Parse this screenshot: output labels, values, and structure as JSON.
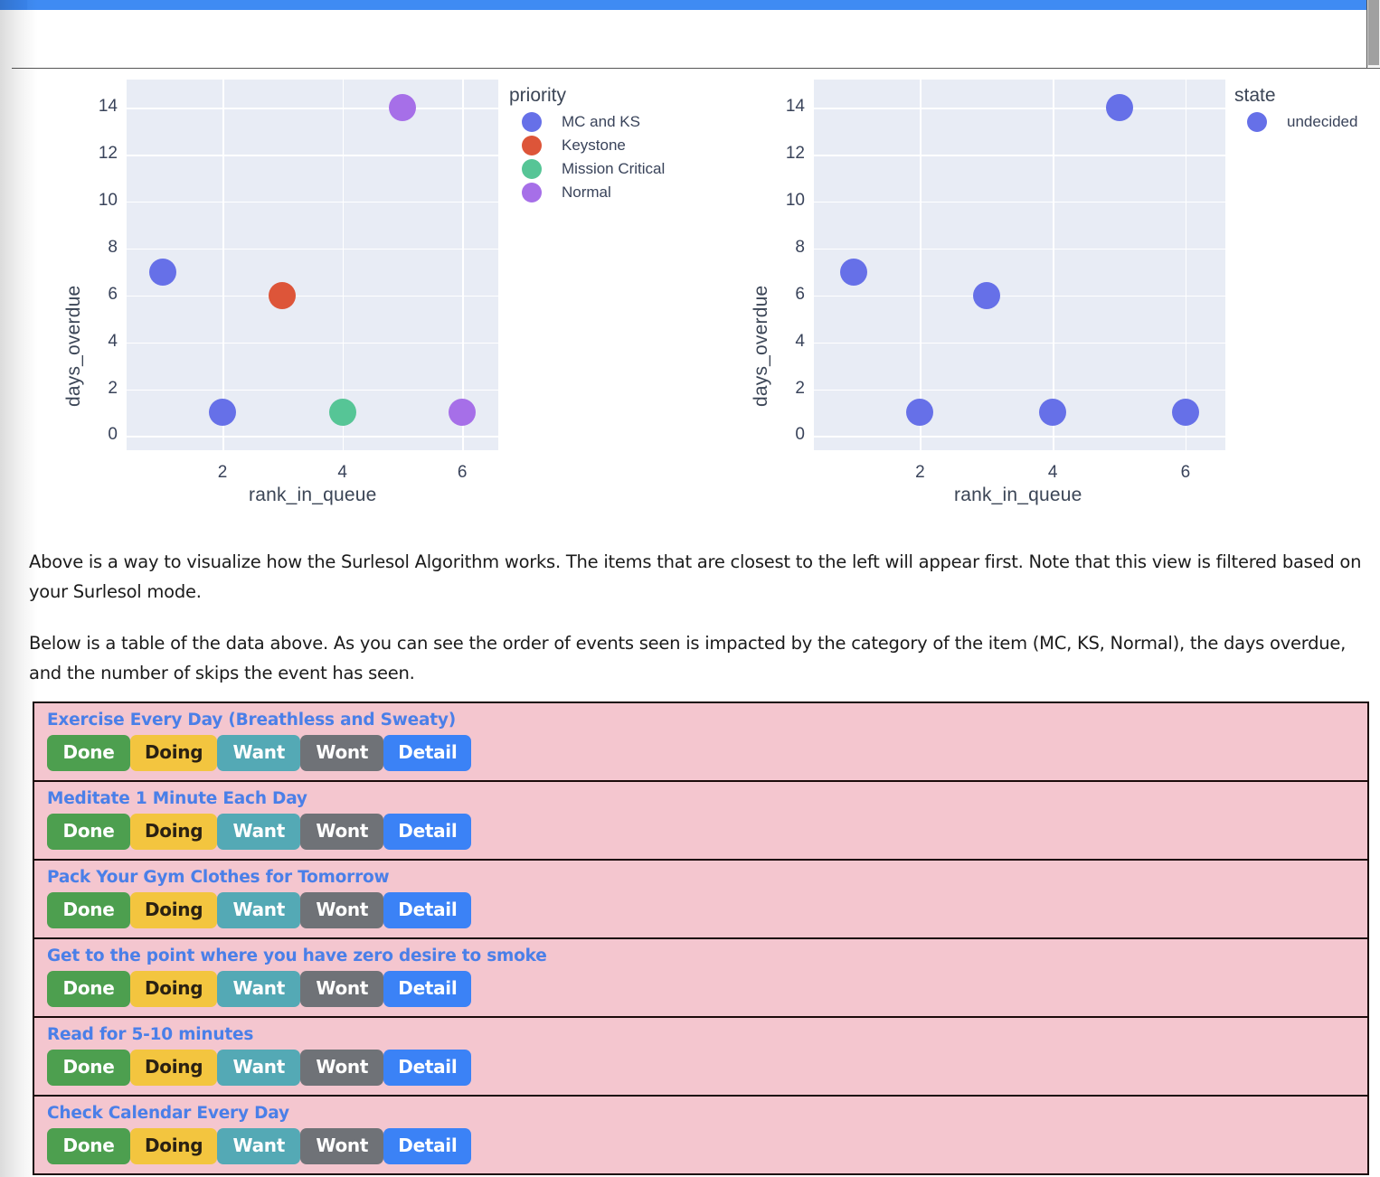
{
  "window": {
    "top_bar_color": "#3f8bf3",
    "scrollbar": {
      "name": "vertical-scrollbar"
    }
  },
  "chart_data": [
    {
      "type": "scatter",
      "title": "",
      "xlabel": "rank_in_queue",
      "ylabel": "days_overdue",
      "xlim": [
        0.4,
        6.6
      ],
      "ylim": [
        -0.6,
        15.2
      ],
      "xticks": [
        2,
        4,
        6
      ],
      "yticks": [
        0,
        2,
        4,
        6,
        8,
        10,
        12,
        14
      ],
      "grid": true,
      "legend": {
        "title": "priority",
        "position": "right",
        "entries": [
          {
            "label": "MC and KS",
            "color": "#6670e8"
          },
          {
            "label": "Keystone",
            "color": "#dd5539"
          },
          {
            "label": "Mission Critical",
            "color": "#56c596"
          },
          {
            "label": "Normal",
            "color": "#a66fe8"
          }
        ]
      },
      "series": [
        {
          "name": "MC and KS",
          "color": "#6670e8",
          "points": [
            [
              1,
              7
            ],
            [
              2,
              1
            ]
          ]
        },
        {
          "name": "Keystone",
          "color": "#dd5539",
          "points": [
            [
              3,
              6
            ]
          ]
        },
        {
          "name": "Mission Critical",
          "color": "#56c596",
          "points": [
            [
              4,
              1
            ]
          ]
        },
        {
          "name": "Normal",
          "color": "#a66fe8",
          "points": [
            [
              5,
              14
            ],
            [
              6,
              1
            ]
          ]
        }
      ]
    },
    {
      "type": "scatter",
      "title": "",
      "xlabel": "rank_in_queue",
      "ylabel": "days_overdue",
      "xlim": [
        0.4,
        6.6
      ],
      "ylim": [
        -0.6,
        15.2
      ],
      "xticks": [
        2,
        4,
        6
      ],
      "yticks": [
        0,
        2,
        4,
        6,
        8,
        10,
        12,
        14
      ],
      "grid": true,
      "legend": {
        "title": "state",
        "position": "right",
        "entries": [
          {
            "label": "undecided",
            "color": "#6670e8"
          }
        ]
      },
      "series": [
        {
          "name": "undecided",
          "color": "#6670e8",
          "points": [
            [
              1,
              7
            ],
            [
              2,
              1
            ],
            [
              3,
              6
            ],
            [
              4,
              1
            ],
            [
              5,
              14
            ],
            [
              6,
              1
            ]
          ]
        }
      ]
    }
  ],
  "paragraphs": [
    "Above is a way to visualize how the Surlesol Algorithm works. The items that are closest to the left will appear first. Note that this view is filtered based on your Surlesol mode.",
    "Below is a table of the data above. As you can see the order of events seen is impacted by the category of the item (MC, KS, Normal), the days overdue, and the number of skips the event has seen."
  ],
  "table": {
    "actions": [
      "Done",
      "Doing",
      "Want",
      "Wont",
      "Detail"
    ],
    "rows": [
      {
        "title": "Exercise Every Day (Breathless and Sweaty)"
      },
      {
        "title": "Meditate 1 Minute Each Day"
      },
      {
        "title": "Pack Your Gym Clothes for Tomorrow"
      },
      {
        "title": "Get to the point where you have zero desire to smoke"
      },
      {
        "title": "Read for 5-10 minutes"
      },
      {
        "title": "Check Calendar Every Day"
      }
    ]
  }
}
